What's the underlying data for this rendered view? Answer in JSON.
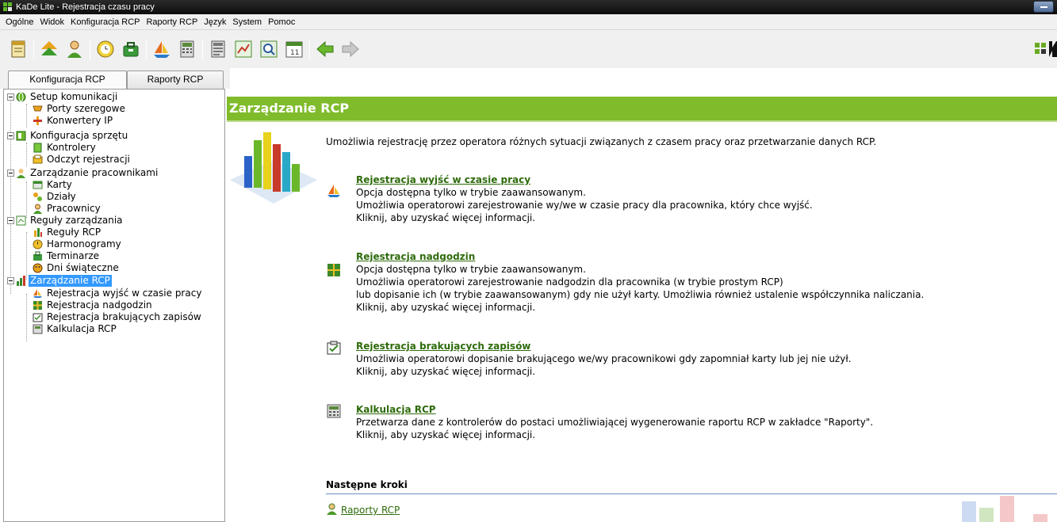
{
  "window": {
    "title": "KaDe Lite - Rejestracja czasu pracy"
  },
  "menu": [
    "Ogólne",
    "Widok",
    "Konfiguracja RCP",
    "Raporty RCP",
    "Język",
    "System",
    "Pomoc"
  ],
  "toolbar": {
    "buttons": [
      "notebook-icon",
      "up-arrows-icon",
      "user-icon",
      "clock-icon",
      "bag-icon",
      "boat-icon",
      "calculator-icon",
      "report-icon",
      "chart-icon",
      "magnifier-icon",
      "calendar-icon",
      "back-arrow-icon",
      "forward-arrow-icon"
    ],
    "accent": "#6aaa22"
  },
  "tabs": [
    {
      "label": "Konfiguracja RCP",
      "active": true
    },
    {
      "label": "Raporty RCP",
      "active": false
    }
  ],
  "tree": {
    "groups": [
      {
        "label": "Setup komunikacji",
        "icon": "globe-icon",
        "children": [
          {
            "label": "Porty szeregowe",
            "icon": "port-icon"
          },
          {
            "label": "Konwertery IP",
            "icon": "converter-icon"
          }
        ]
      },
      {
        "label": "Konfiguracja sprzętu",
        "icon": "hardware-icon",
        "children": [
          {
            "label": "Kontrolery",
            "icon": "controller-icon"
          },
          {
            "label": "Odczyt rejestracji",
            "icon": "reader-icon"
          }
        ]
      },
      {
        "label": "Zarządzanie pracownikami",
        "icon": "users-icon",
        "children": [
          {
            "label": "Karty",
            "icon": "card-icon"
          },
          {
            "label": "Działy",
            "icon": "departments-icon"
          },
          {
            "label": "Pracownicy",
            "icon": "employee-icon"
          }
        ]
      },
      {
        "label": "Reguły zarządzania",
        "icon": "rules-icon",
        "children": [
          {
            "label": "Reguły RCP",
            "icon": "rule-icon"
          },
          {
            "label": "Harmonogramy",
            "icon": "schedule-icon"
          },
          {
            "label": "Terminarze",
            "icon": "terminarz-icon"
          },
          {
            "label": "Dni świąteczne",
            "icon": "holiday-icon"
          }
        ]
      },
      {
        "label": "Zarządzanie RCP",
        "icon": "bars-icon",
        "selected": true,
        "children": [
          {
            "label": "Rejestracja wyjść w czasie pracy",
            "icon": "boat-icon"
          },
          {
            "label": "Rejestracja nadgodzin",
            "icon": "plus-grid-icon"
          },
          {
            "label": "Rejestracja brakujących zapisów",
            "icon": "checklist-icon"
          },
          {
            "label": "Kalkulacja RCP",
            "icon": "calculator-icon"
          }
        ]
      }
    ]
  },
  "content": {
    "banner_title": "Zarządzanie RCP",
    "banner_color": "#7fbb2b",
    "link_color": "#2e6b0b",
    "intro": "Umożliwia rejestrację przez operatora różnych sytuacji związanych z czasem pracy oraz przetwarzanie danych RCP.",
    "sections": [
      {
        "title": "Rejestracja wyjść w czasie pracy",
        "icon": "boat-icon",
        "lines": [
          "Opcja dostępna tylko w trybie zaawansowanym.",
          "Umożliwia operatorowi zarejestrowanie wy/we w czasie pracy dla pracownika, który chce wyjść.",
          "Kliknij, aby uzyskać więcej informacji."
        ]
      },
      {
        "title": "Rejestracja nadgodzin",
        "icon": "plus-grid-icon",
        "lines": [
          "Opcja dostępna tylko w trybie zaawansowanym.",
          "Umożliwia operatorowi zarejestrowanie nadgodzin dla pracownika (w trybie prostym RCP)",
          "lub dopisanie ich (w trybie zaawansowanym) gdy nie użył karty. Umożliwia również ustalenie współczynnika naliczania.",
          "Kliknij, aby uzyskać więcej informacji."
        ]
      },
      {
        "title": "Rejestracja brakujących zapisów",
        "icon": "checklist-icon",
        "lines": [
          "Umożliwia operatorowi dopisanie brakującego we/wy pracownikowi gdy zapomniał karty lub jej nie użył.",
          "Kliknij, aby uzyskać więcej informacji."
        ]
      },
      {
        "title": "Kalkulacja RCP",
        "icon": "calculator-icon",
        "lines": [
          "Przetwarza dane z kontrolerów do postaci umożliwiającej wygenerowanie raportu RCP w zakładce \"Raporty\".",
          "Kliknij, aby uzyskać więcej informacji."
        ]
      }
    ],
    "next_steps_title": "Następne kroki",
    "next_steps_link": "Raporty RCP"
  }
}
